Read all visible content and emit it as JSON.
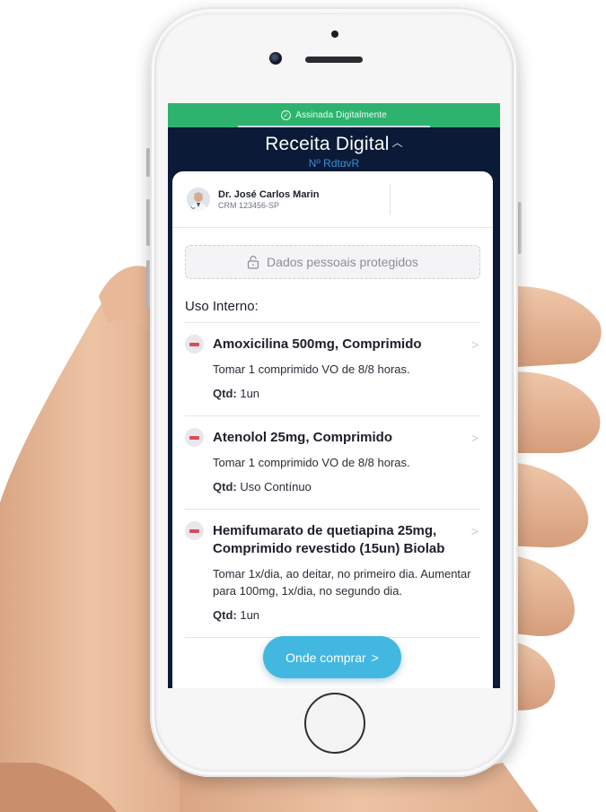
{
  "header": {
    "signed_label": "Assinada Digitalmente",
    "title": "Receita Digital",
    "number": "Nº RdtqvR"
  },
  "doctor": {
    "name": "Dr. José Carlos Marin",
    "crm": "CRM 123456-SP"
  },
  "protected_label": "Dados pessoais protegidos",
  "section_title": "Uso Interno:",
  "qty_label": "Qtd:",
  "medications": [
    {
      "name": "Amoxicilina 500mg, Comprimido",
      "instructions": "Tomar 1 comprimido VO de 8/8 horas.",
      "qty": "1un"
    },
    {
      "name": "Atenolol 25mg, Comprimido",
      "instructions": "Tomar 1 comprimido VO de 8/8 horas.",
      "qty": "Uso Contínuo"
    },
    {
      "name": "Hemifumarato de quetiapina 25mg, Comprimido revestido (15un) Biolab",
      "instructions": "Tomar 1x/dia, ao deitar, no primeiro dia. Aumentar para 100mg, 1x/dia, no segundo dia.",
      "qty": "1un"
    }
  ],
  "buy_button": "Onde comprar",
  "colors": {
    "signed_bar": "#2db36e",
    "header_bg": "#0b1a36",
    "button": "#42b7e0",
    "pill": "#e04a50"
  },
  "icons": [
    "check-circle-icon",
    "lock-icon",
    "pill-icon",
    "chevron-right-icon",
    "chevron-up-icon"
  ]
}
